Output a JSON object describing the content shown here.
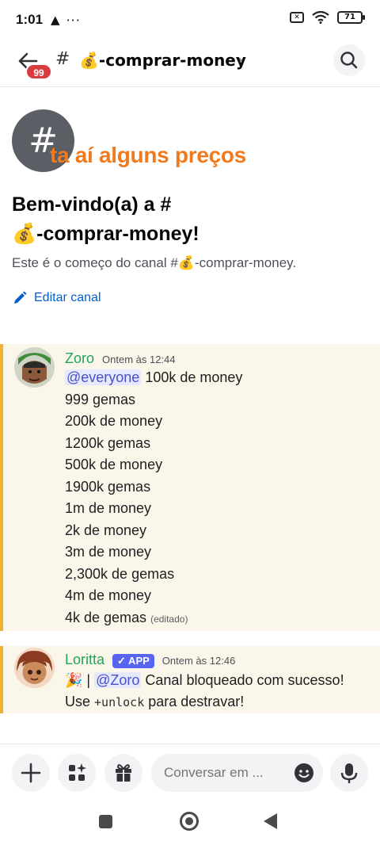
{
  "status_bar": {
    "time": "1:01",
    "warning_icon": "warning-icon",
    "more": "···",
    "battery": "71"
  },
  "header": {
    "unread_badge": "99",
    "hash": "#",
    "channel_emoji": "💰",
    "channel_name": "-comprar-money",
    "chevron": "›"
  },
  "intro": {
    "hash": "#",
    "overlay_text": "ta aí alguns preços",
    "welcome_line1": "Bem-vindo(a) a #",
    "welcome_emoji": "💰",
    "welcome_line2": "-comprar-money!",
    "description_prefix": "Este é o começo do canal #",
    "description_emoji": "💰",
    "description_suffix": "-comprar-money.",
    "edit_label": "Editar canal"
  },
  "messages": [
    {
      "author": "Zoro",
      "timestamp": "Ontem às 12:44",
      "mention": "@everyone",
      "first_line_rest": " 100k de money",
      "lines": [
        "999 gemas",
        "200k de money",
        "1200k gemas",
        "500k de money",
        "1900k gemas",
        "1m de money",
        "2k de money",
        "3m de money",
        "2,300k de gemas",
        "4m de money"
      ],
      "last_line": "4k de gemas",
      "edited": "(editado)"
    },
    {
      "author": "Loritta",
      "app_tag": "✓ APP",
      "timestamp": "Ontem às 12:46",
      "emoji": "🎉",
      "separator": " | ",
      "mention": "@Zoro",
      "text1": " Canal bloqueado com sucesso!",
      "text2_prefix": "Use ",
      "code": "+unlock",
      "text2_suffix": " para destravar!"
    }
  ],
  "composer": {
    "placeholder": "Conversar em ..."
  },
  "colors": {
    "accent_orange": "#f07a1e",
    "author_green": "#23a559",
    "highlight_bg": "#faf6e9",
    "highlight_bar": "#f0b232",
    "mention_bg": "#e6e8fd",
    "app_tag": "#5865f2"
  }
}
